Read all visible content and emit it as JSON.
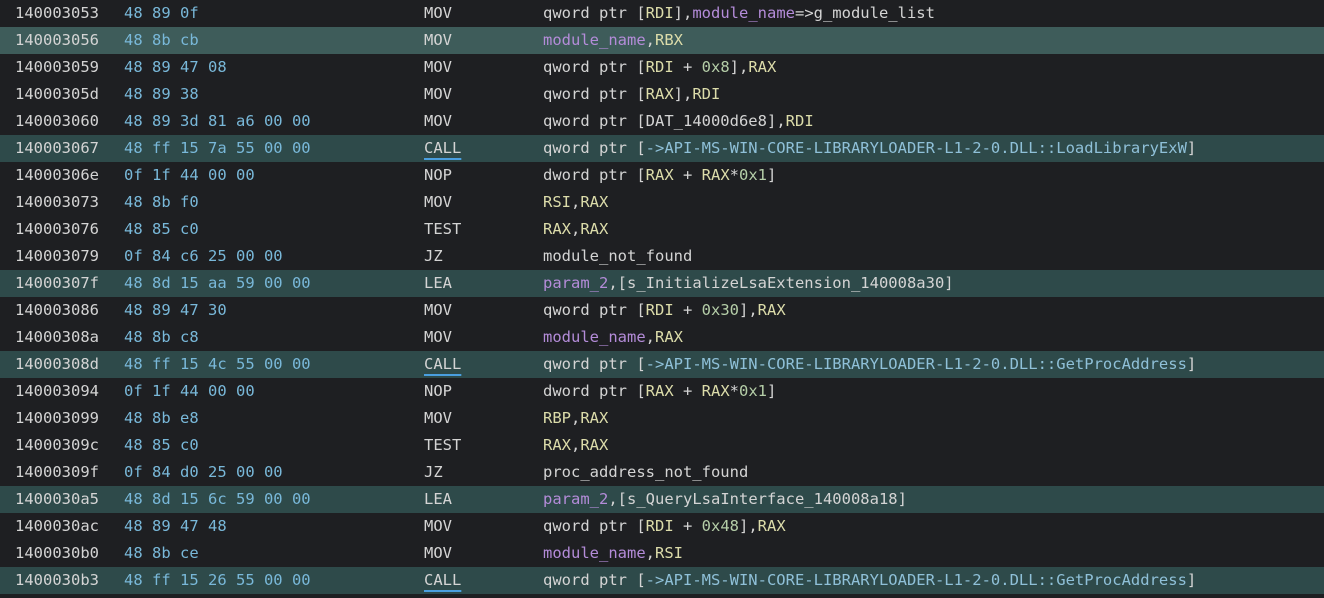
{
  "colors": {
    "background": "#1e1f22",
    "highlight_row": "#2e4a4a",
    "selected_row": "#3e5c5a",
    "bytes": "#79b8d9",
    "register": "#dcdcaa",
    "hex_constant": "#b5cea8",
    "variable": "#b48cd9",
    "external_ref": "#8fc0d8",
    "call_underline": "#4a9fe0"
  },
  "rows": [
    {
      "address": "140003053",
      "bytes": "48 89 0f",
      "mnemonic": "MOV",
      "highlight": false,
      "selected": false,
      "operands": [
        {
          "text": "qword ptr [",
          "kind": "text"
        },
        {
          "text": "RDI",
          "kind": "reg"
        },
        {
          "text": "],",
          "kind": "text"
        },
        {
          "text": "module_name",
          "kind": "var"
        },
        {
          "text": "=>g_module_list",
          "kind": "text"
        }
      ]
    },
    {
      "address": "140003056",
      "bytes": "48 8b cb",
      "mnemonic": "MOV",
      "highlight": true,
      "selected": true,
      "operands": [
        {
          "text": "module_name",
          "kind": "var"
        },
        {
          "text": ",",
          "kind": "text"
        },
        {
          "text": "RBX",
          "kind": "reg"
        }
      ]
    },
    {
      "address": "140003059",
      "bytes": "48 89 47 08",
      "mnemonic": "MOV",
      "highlight": false,
      "selected": false,
      "operands": [
        {
          "text": "qword ptr [",
          "kind": "text"
        },
        {
          "text": "RDI",
          "kind": "reg"
        },
        {
          "text": " + ",
          "kind": "text"
        },
        {
          "text": "0x8",
          "kind": "hex"
        },
        {
          "text": "],",
          "kind": "text"
        },
        {
          "text": "RAX",
          "kind": "reg"
        }
      ]
    },
    {
      "address": "14000305d",
      "bytes": "48 89 38",
      "mnemonic": "MOV",
      "highlight": false,
      "selected": false,
      "operands": [
        {
          "text": "qword ptr [",
          "kind": "text"
        },
        {
          "text": "RAX",
          "kind": "reg"
        },
        {
          "text": "],",
          "kind": "text"
        },
        {
          "text": "RDI",
          "kind": "reg"
        }
      ]
    },
    {
      "address": "140003060",
      "bytes": "48 89 3d 81 a6 00 00",
      "mnemonic": "MOV",
      "highlight": false,
      "selected": false,
      "operands": [
        {
          "text": "qword ptr [",
          "kind": "text"
        },
        {
          "text": "DAT_14000d6e8",
          "kind": "label"
        },
        {
          "text": "],",
          "kind": "text"
        },
        {
          "text": "RDI",
          "kind": "reg"
        }
      ]
    },
    {
      "address": "140003067",
      "bytes": "48 ff 15 7a 55 00 00",
      "mnemonic": "CALL",
      "highlight": true,
      "selected": false,
      "operands": [
        {
          "text": "qword ptr [",
          "kind": "text"
        },
        {
          "text": "->API-MS-WIN-CORE-LIBRARYLOADER-L1-2-0.DLL::LoadLibraryExW",
          "kind": "ext"
        },
        {
          "text": "]",
          "kind": "text"
        }
      ]
    },
    {
      "address": "14000306e",
      "bytes": "0f 1f 44 00 00",
      "mnemonic": "NOP",
      "highlight": false,
      "selected": false,
      "operands": [
        {
          "text": "dword ptr [",
          "kind": "text"
        },
        {
          "text": "RAX",
          "kind": "reg"
        },
        {
          "text": " + ",
          "kind": "text"
        },
        {
          "text": "RAX",
          "kind": "reg"
        },
        {
          "text": "*",
          "kind": "text"
        },
        {
          "text": "0x1",
          "kind": "hex"
        },
        {
          "text": "]",
          "kind": "text"
        }
      ]
    },
    {
      "address": "140003073",
      "bytes": "48 8b f0",
      "mnemonic": "MOV",
      "highlight": false,
      "selected": false,
      "operands": [
        {
          "text": "RSI",
          "kind": "reg"
        },
        {
          "text": ",",
          "kind": "text"
        },
        {
          "text": "RAX",
          "kind": "reg"
        }
      ]
    },
    {
      "address": "140003076",
      "bytes": "48 85 c0",
      "mnemonic": "TEST",
      "highlight": false,
      "selected": false,
      "operands": [
        {
          "text": "RAX",
          "kind": "reg"
        },
        {
          "text": ",",
          "kind": "text"
        },
        {
          "text": "RAX",
          "kind": "reg"
        }
      ]
    },
    {
      "address": "140003079",
      "bytes": "0f 84 c6 25 00 00",
      "mnemonic": "JZ",
      "highlight": false,
      "selected": false,
      "operands": [
        {
          "text": "module_not_found",
          "kind": "label"
        }
      ]
    },
    {
      "address": "14000307f",
      "bytes": "48 8d 15 aa 59 00 00",
      "mnemonic": "LEA",
      "highlight": true,
      "selected": false,
      "operands": [
        {
          "text": "param_2",
          "kind": "var"
        },
        {
          "text": ",[",
          "kind": "text"
        },
        {
          "text": "s_InitializeLsaExtension_140008a30",
          "kind": "label"
        },
        {
          "text": "]",
          "kind": "text"
        }
      ]
    },
    {
      "address": "140003086",
      "bytes": "48 89 47 30",
      "mnemonic": "MOV",
      "highlight": false,
      "selected": false,
      "operands": [
        {
          "text": "qword ptr [",
          "kind": "text"
        },
        {
          "text": "RDI",
          "kind": "reg"
        },
        {
          "text": " + ",
          "kind": "text"
        },
        {
          "text": "0x30",
          "kind": "hex"
        },
        {
          "text": "],",
          "kind": "text"
        },
        {
          "text": "RAX",
          "kind": "reg"
        }
      ]
    },
    {
      "address": "14000308a",
      "bytes": "48 8b c8",
      "mnemonic": "MOV",
      "highlight": false,
      "selected": false,
      "operands": [
        {
          "text": "module_name",
          "kind": "var"
        },
        {
          "text": ",",
          "kind": "text"
        },
        {
          "text": "RAX",
          "kind": "reg"
        }
      ]
    },
    {
      "address": "14000308d",
      "bytes": "48 ff 15 4c 55 00 00",
      "mnemonic": "CALL",
      "highlight": true,
      "selected": false,
      "operands": [
        {
          "text": "qword ptr [",
          "kind": "text"
        },
        {
          "text": "->API-MS-WIN-CORE-LIBRARYLOADER-L1-2-0.DLL::GetProcAddress",
          "kind": "ext"
        },
        {
          "text": "]",
          "kind": "text"
        }
      ]
    },
    {
      "address": "140003094",
      "bytes": "0f 1f 44 00 00",
      "mnemonic": "NOP",
      "highlight": false,
      "selected": false,
      "operands": [
        {
          "text": "dword ptr [",
          "kind": "text"
        },
        {
          "text": "RAX",
          "kind": "reg"
        },
        {
          "text": " + ",
          "kind": "text"
        },
        {
          "text": "RAX",
          "kind": "reg"
        },
        {
          "text": "*",
          "kind": "text"
        },
        {
          "text": "0x1",
          "kind": "hex"
        },
        {
          "text": "]",
          "kind": "text"
        }
      ]
    },
    {
      "address": "140003099",
      "bytes": "48 8b e8",
      "mnemonic": "MOV",
      "highlight": false,
      "selected": false,
      "operands": [
        {
          "text": "RBP",
          "kind": "reg"
        },
        {
          "text": ",",
          "kind": "text"
        },
        {
          "text": "RAX",
          "kind": "reg"
        }
      ]
    },
    {
      "address": "14000309c",
      "bytes": "48 85 c0",
      "mnemonic": "TEST",
      "highlight": false,
      "selected": false,
      "operands": [
        {
          "text": "RAX",
          "kind": "reg"
        },
        {
          "text": ",",
          "kind": "text"
        },
        {
          "text": "RAX",
          "kind": "reg"
        }
      ]
    },
    {
      "address": "14000309f",
      "bytes": "0f 84 d0 25 00 00",
      "mnemonic": "JZ",
      "highlight": false,
      "selected": false,
      "operands": [
        {
          "text": "proc_address_not_found",
          "kind": "label"
        }
      ]
    },
    {
      "address": "1400030a5",
      "bytes": "48 8d 15 6c 59 00 00",
      "mnemonic": "LEA",
      "highlight": true,
      "selected": false,
      "operands": [
        {
          "text": "param_2",
          "kind": "var"
        },
        {
          "text": ",[",
          "kind": "text"
        },
        {
          "text": "s_QueryLsaInterface_140008a18",
          "kind": "label"
        },
        {
          "text": "]",
          "kind": "text"
        }
      ]
    },
    {
      "address": "1400030ac",
      "bytes": "48 89 47 48",
      "mnemonic": "MOV",
      "highlight": false,
      "selected": false,
      "operands": [
        {
          "text": "qword ptr [",
          "kind": "text"
        },
        {
          "text": "RDI",
          "kind": "reg"
        },
        {
          "text": " + ",
          "kind": "text"
        },
        {
          "text": "0x48",
          "kind": "hex"
        },
        {
          "text": "],",
          "kind": "text"
        },
        {
          "text": "RAX",
          "kind": "reg"
        }
      ]
    },
    {
      "address": "1400030b0",
      "bytes": "48 8b ce",
      "mnemonic": "MOV",
      "highlight": false,
      "selected": false,
      "operands": [
        {
          "text": "module_name",
          "kind": "var"
        },
        {
          "text": ",",
          "kind": "text"
        },
        {
          "text": "RSI",
          "kind": "reg"
        }
      ]
    },
    {
      "address": "1400030b3",
      "bytes": "48 ff 15 26 55 00 00",
      "mnemonic": "CALL",
      "highlight": true,
      "selected": false,
      "operands": [
        {
          "text": "qword ptr [",
          "kind": "text"
        },
        {
          "text": "->API-MS-WIN-CORE-LIBRARYLOADER-L1-2-0.DLL::GetProcAddress",
          "kind": "ext"
        },
        {
          "text": "]",
          "kind": "text"
        }
      ]
    }
  ]
}
